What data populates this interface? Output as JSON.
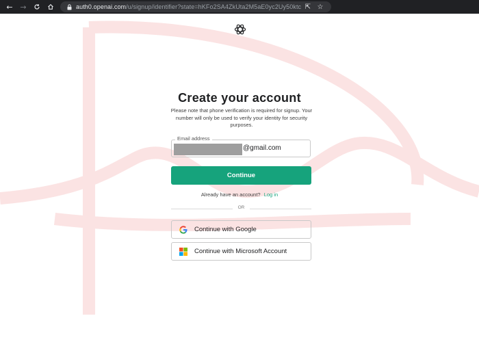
{
  "browser": {
    "url_host": "auth0.openai.com",
    "url_path": "/u/signup/identifier?state=hKFo2SA4ZkUta2M5aE0yc2Uy50ktc..."
  },
  "page": {
    "title": "Create your account",
    "note": "Please note that phone verification is required for signup. Your number will only be used to verify your identity for security purposes.",
    "email": {
      "label": "Email address",
      "value_visible": "@gmail.com"
    },
    "continue_label": "Continue",
    "account_prompt": "Already have an account?",
    "login_link": "Log in",
    "divider_text": "OR",
    "social": [
      {
        "label": "Continue with Google",
        "icon": "google-icon"
      },
      {
        "label": "Continue with Microsoft Account",
        "icon": "microsoft-icon"
      }
    ]
  },
  "colors": {
    "accent": "#16a37c",
    "browser_bar": "#202124",
    "watermark": "#fbe3e3"
  }
}
